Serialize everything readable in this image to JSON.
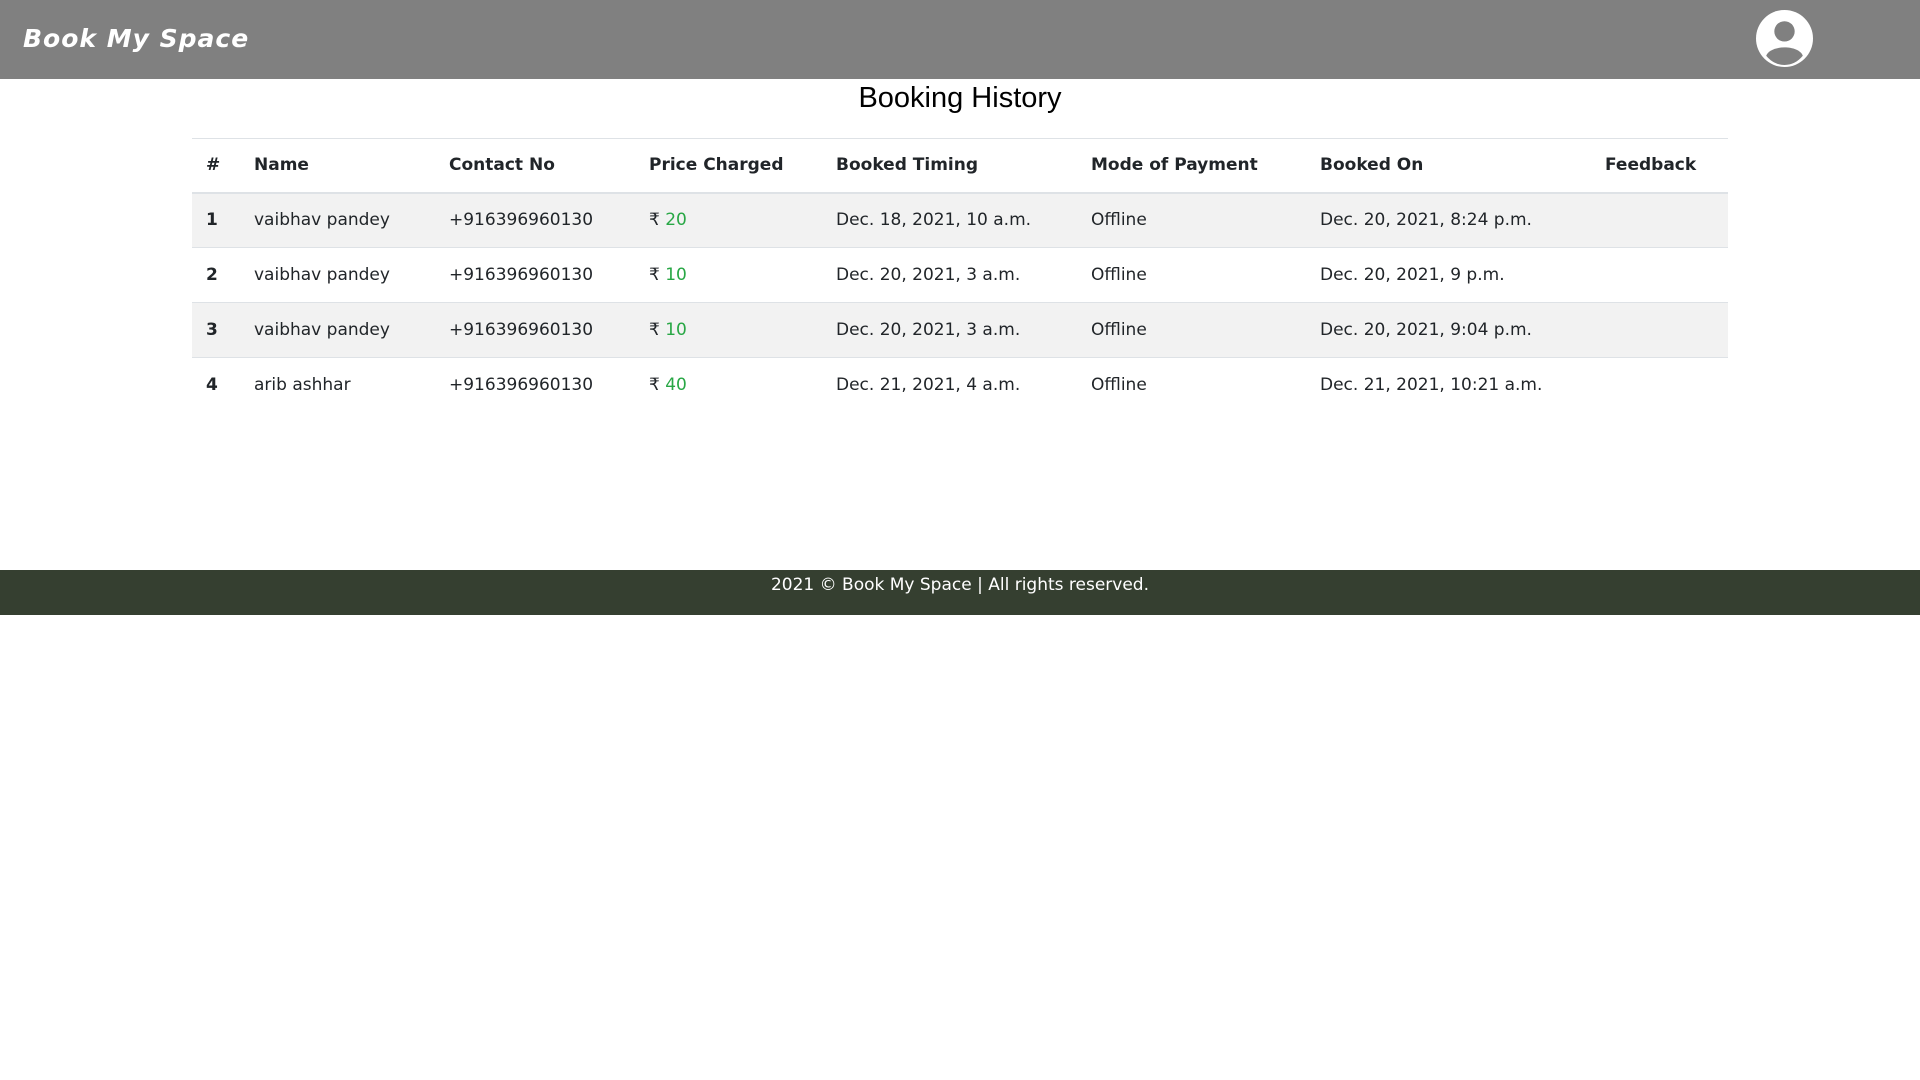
{
  "navbar": {
    "brand": "Book My Space",
    "avatar_icon": "user-circle-icon"
  },
  "page": {
    "title": "Booking History"
  },
  "table": {
    "headers": [
      "#",
      "Name",
      "Contact No",
      "Price Charged",
      "Booked Timing",
      "Mode of Payment",
      "Booked On",
      "Feedback"
    ],
    "currency_symbol": "₹",
    "rows": [
      {
        "index": "1",
        "name": "vaibhav pandey",
        "contact": "+916396960130",
        "price": "20",
        "timing": "Dec. 18, 2021, 10 a.m.",
        "payment": "Offline",
        "booked_on": "Dec. 20, 2021, 8:24 p.m.",
        "feedback": ""
      },
      {
        "index": "2",
        "name": "vaibhav pandey",
        "contact": "+916396960130",
        "price": "10",
        "timing": "Dec. 20, 2021, 3 a.m.",
        "payment": "Offline",
        "booked_on": "Dec. 20, 2021, 9 p.m.",
        "feedback": ""
      },
      {
        "index": "3",
        "name": "vaibhav pandey",
        "contact": "+916396960130",
        "price": "10",
        "timing": "Dec. 20, 2021, 3 a.m.",
        "payment": "Offline",
        "booked_on": "Dec. 20, 2021, 9:04 p.m.",
        "feedback": ""
      },
      {
        "index": "4",
        "name": "arib ashhar",
        "contact": "+916396960130",
        "price": "40",
        "timing": "Dec. 21, 2021, 4 a.m.",
        "payment": "Offline",
        "booked_on": "Dec. 21, 2021, 10:21 a.m.",
        "feedback": ""
      }
    ]
  },
  "footer": {
    "text": "2021 © Book My Space | All rights reserved."
  },
  "colors": {
    "navbar_bg": "#808080",
    "footer_bg": "#353f30",
    "price_green": "#28a745",
    "stripe": "#f2f2f2"
  }
}
